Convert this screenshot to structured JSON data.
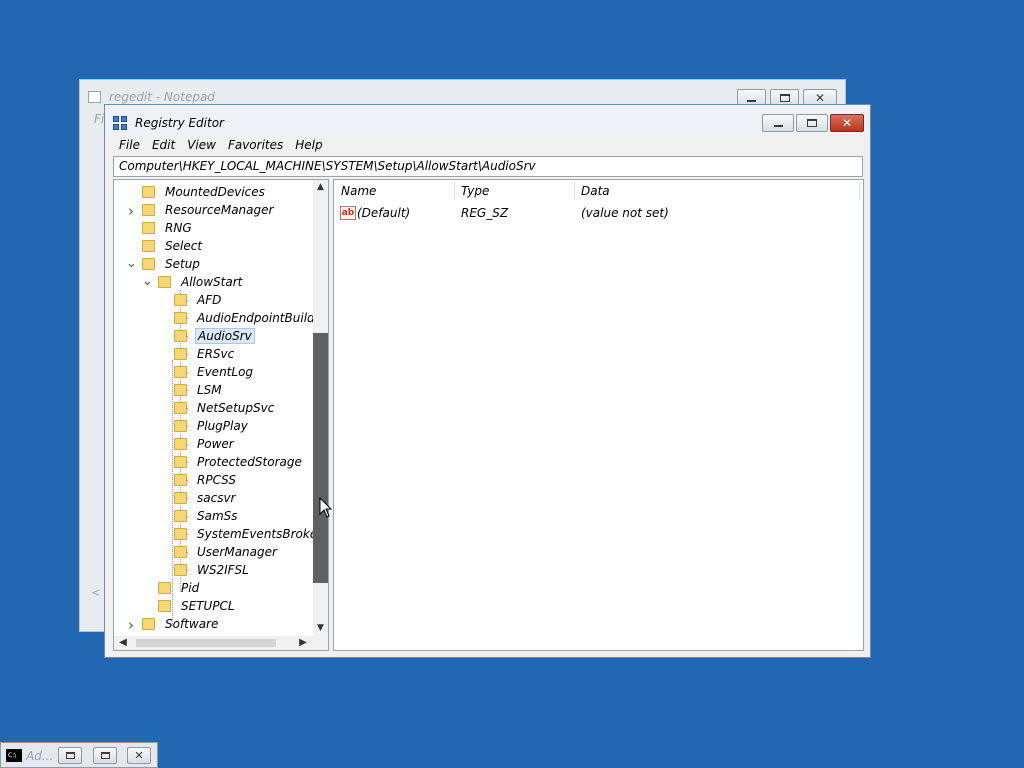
{
  "notepad": {
    "title": "regedit - Notepad",
    "menu_partial": "Fi",
    "scroll_arrow": "<"
  },
  "regedit": {
    "title": "Registry Editor",
    "menu": [
      "File",
      "Edit",
      "View",
      "Favorites",
      "Help"
    ],
    "address": "Computer\\HKEY_LOCAL_MACHINE\\SYSTEM\\Setup\\AllowStart\\AudioSrv",
    "tree": [
      {
        "label": "MountedDevices",
        "level": 0,
        "expander": ""
      },
      {
        "label": "ResourceManager",
        "level": 0,
        "expander": "collapsed"
      },
      {
        "label": "RNG",
        "level": 0,
        "expander": ""
      },
      {
        "label": "Select",
        "level": 0,
        "expander": ""
      },
      {
        "label": "Setup",
        "level": 0,
        "expander": "expanded"
      },
      {
        "label": "AllowStart",
        "level": 1,
        "expander": "expanded"
      },
      {
        "label": "AFD",
        "level": 2,
        "expander": ""
      },
      {
        "label": "AudioEndpointBuilder",
        "level": 2,
        "expander": ""
      },
      {
        "label": "AudioSrv",
        "level": 2,
        "expander": "",
        "selected": true
      },
      {
        "label": "ERSvc",
        "level": 2,
        "expander": ""
      },
      {
        "label": "EventLog",
        "level": 2,
        "expander": ""
      },
      {
        "label": "LSM",
        "level": 2,
        "expander": ""
      },
      {
        "label": "NetSetupSvc",
        "level": 2,
        "expander": ""
      },
      {
        "label": "PlugPlay",
        "level": 2,
        "expander": ""
      },
      {
        "label": "Power",
        "level": 2,
        "expander": ""
      },
      {
        "label": "ProtectedStorage",
        "level": 2,
        "expander": ""
      },
      {
        "label": "RPCSS",
        "level": 2,
        "expander": ""
      },
      {
        "label": "sacsvr",
        "level": 2,
        "expander": ""
      },
      {
        "label": "SamSs",
        "level": 2,
        "expander": ""
      },
      {
        "label": "SystemEventsBroker",
        "level": 2,
        "expander": ""
      },
      {
        "label": "UserManager",
        "level": 2,
        "expander": ""
      },
      {
        "label": "WS2IFSL",
        "level": 2,
        "expander": ""
      },
      {
        "label": "Pid",
        "level": 1,
        "expander": ""
      },
      {
        "label": "SETUPCL",
        "level": 1,
        "expander": ""
      },
      {
        "label": "Software",
        "level": 0,
        "expander": "collapsed"
      }
    ],
    "columns": {
      "name": "Name",
      "type": "Type",
      "data": "Data"
    },
    "values": [
      {
        "icon": "ab",
        "name": "(Default)",
        "type": "REG_SZ",
        "data": "(value not set)"
      }
    ]
  },
  "taskbar": {
    "title": "Ad...",
    "icon_text": "C:\\"
  },
  "colors": {
    "desktop": "#2167b2",
    "close_button": "#c9412f",
    "selection": "#d9e8fb"
  }
}
